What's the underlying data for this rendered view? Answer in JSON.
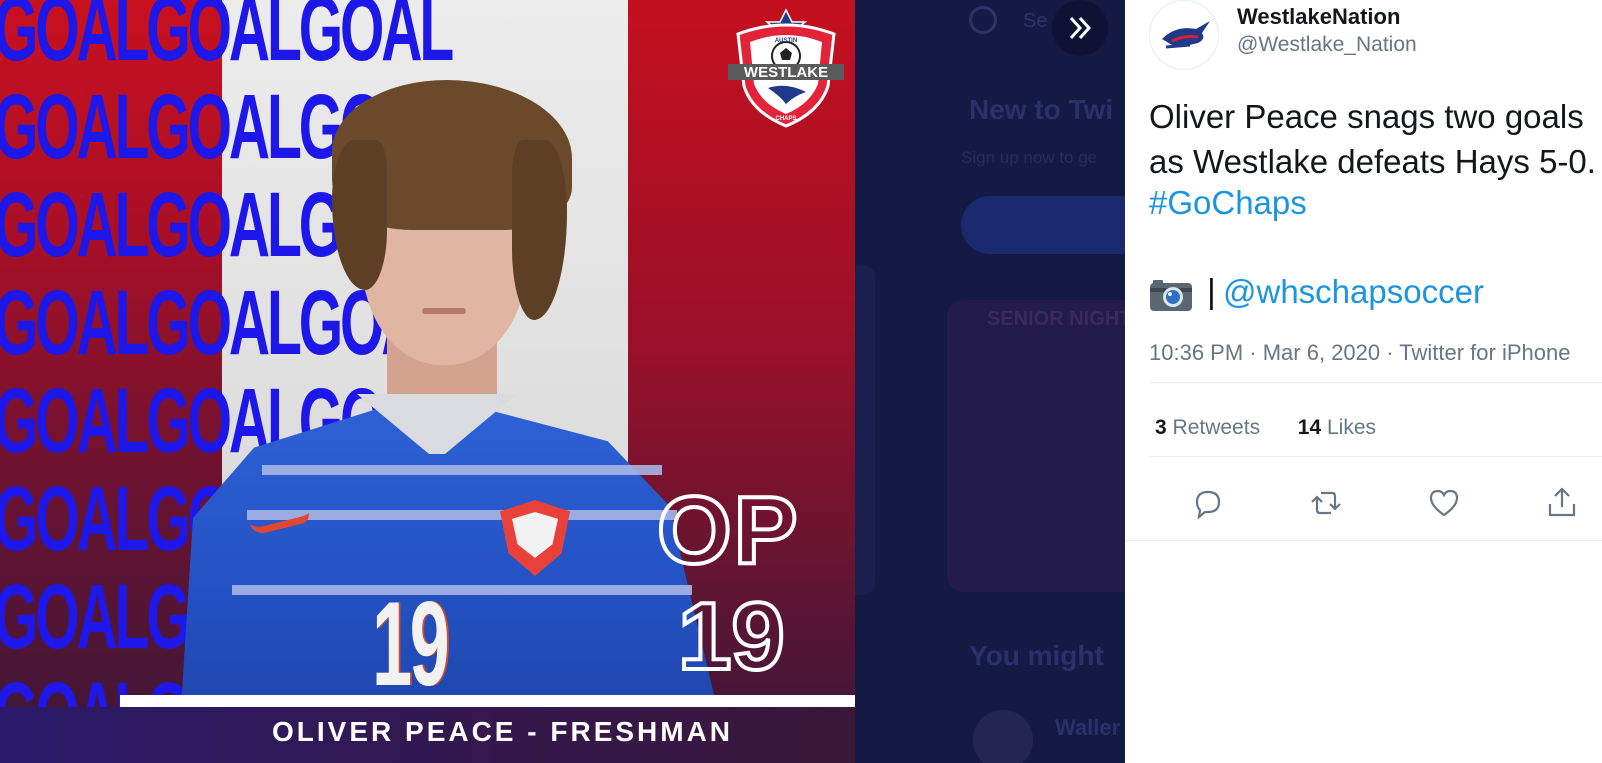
{
  "media": {
    "goal_lines": [
      "GOALGOALGOAL",
      "GOALGOALGOAL",
      "GOALGOALGOAL",
      "GOALGOALGOAL",
      "GOALGOALGOAL",
      "GOALGOALGOAL",
      "GOALGOALGOAL",
      "GOALGOALGOAL"
    ],
    "crest_text": "WESTLAKE",
    "crest_subtext": "CHAPS",
    "crest_top_text": "AUSTIN",
    "jersey_number": "19",
    "initials": "OP",
    "number": "19",
    "caption": "OLIVER PEACE - FRESHMAN"
  },
  "background_page": {
    "search_placeholder": "Se",
    "heading": "New to Twi",
    "subtext": "Sign up now to ge",
    "heading2": "You might",
    "person_name": "Waller",
    "card_text": "SENIOR NIGHT"
  },
  "tweet": {
    "display_name": "WestlakeNation",
    "handle": "@Westlake_Nation",
    "text": "Oliver Peace snags two goals\nas Westlake defeats Hays 5-0.",
    "hashtag": "#GoChaps",
    "separator": "|",
    "mention": "@whschapsoccer",
    "meta": "10:36 PM · Mar 6, 2020 · Twitter for iPhone",
    "retweets_count": "3",
    "retweets_label": "Retweets",
    "likes_count": "14",
    "likes_label": "Likes"
  },
  "colors": {
    "link": "#1b95e0",
    "goal_text": "#1d17ea",
    "red": "#c8101f"
  }
}
